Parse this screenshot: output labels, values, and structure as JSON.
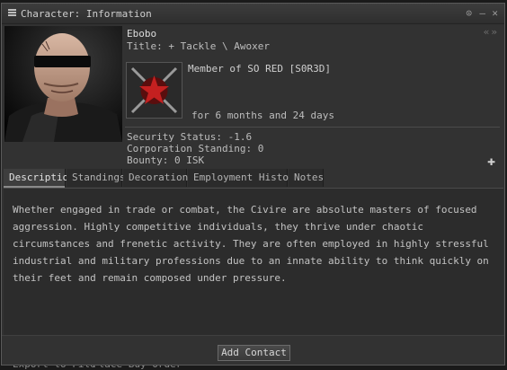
{
  "window": {
    "title": "Character: Information"
  },
  "character": {
    "name": "Ebobo",
    "title": "Title: + Tackle \\ Awoxer",
    "membership": "Member of SO RED [S0R3D]",
    "duration": "for 6 months and 24 days",
    "security_status": "Security Status: -1.6",
    "corp_standing": "Corporation Standing: 0",
    "bounty": "Bounty: 0 ISK"
  },
  "tabs": [
    {
      "label": "Description",
      "active": true
    },
    {
      "label": "Standings"
    },
    {
      "label": "Decorations"
    },
    {
      "label": "Employment History"
    },
    {
      "label": "Notes"
    }
  ],
  "description": "Whether engaged in trade or combat, the Civire are absolute masters of focused aggression. Highly competitive individuals, they thrive under chaotic circumstances and frenetic activity. They are often employed in highly stressful industrial and military professions due to an innate ability to think quickly on their feet and remain composed under pressure.",
  "buttons": {
    "add_contact": "Add Contact"
  },
  "background_fragments": {
    "left": "Export to File",
    "right": "Place Buy Order"
  },
  "colors": {
    "window_bg": "#323232",
    "accent_red": "#8b1a1a"
  },
  "icons": [
    "menu-icon",
    "info-icon",
    "minimize-icon",
    "close-icon",
    "back-arrow-icon",
    "forward-arrow-icon",
    "plus-icon"
  ]
}
